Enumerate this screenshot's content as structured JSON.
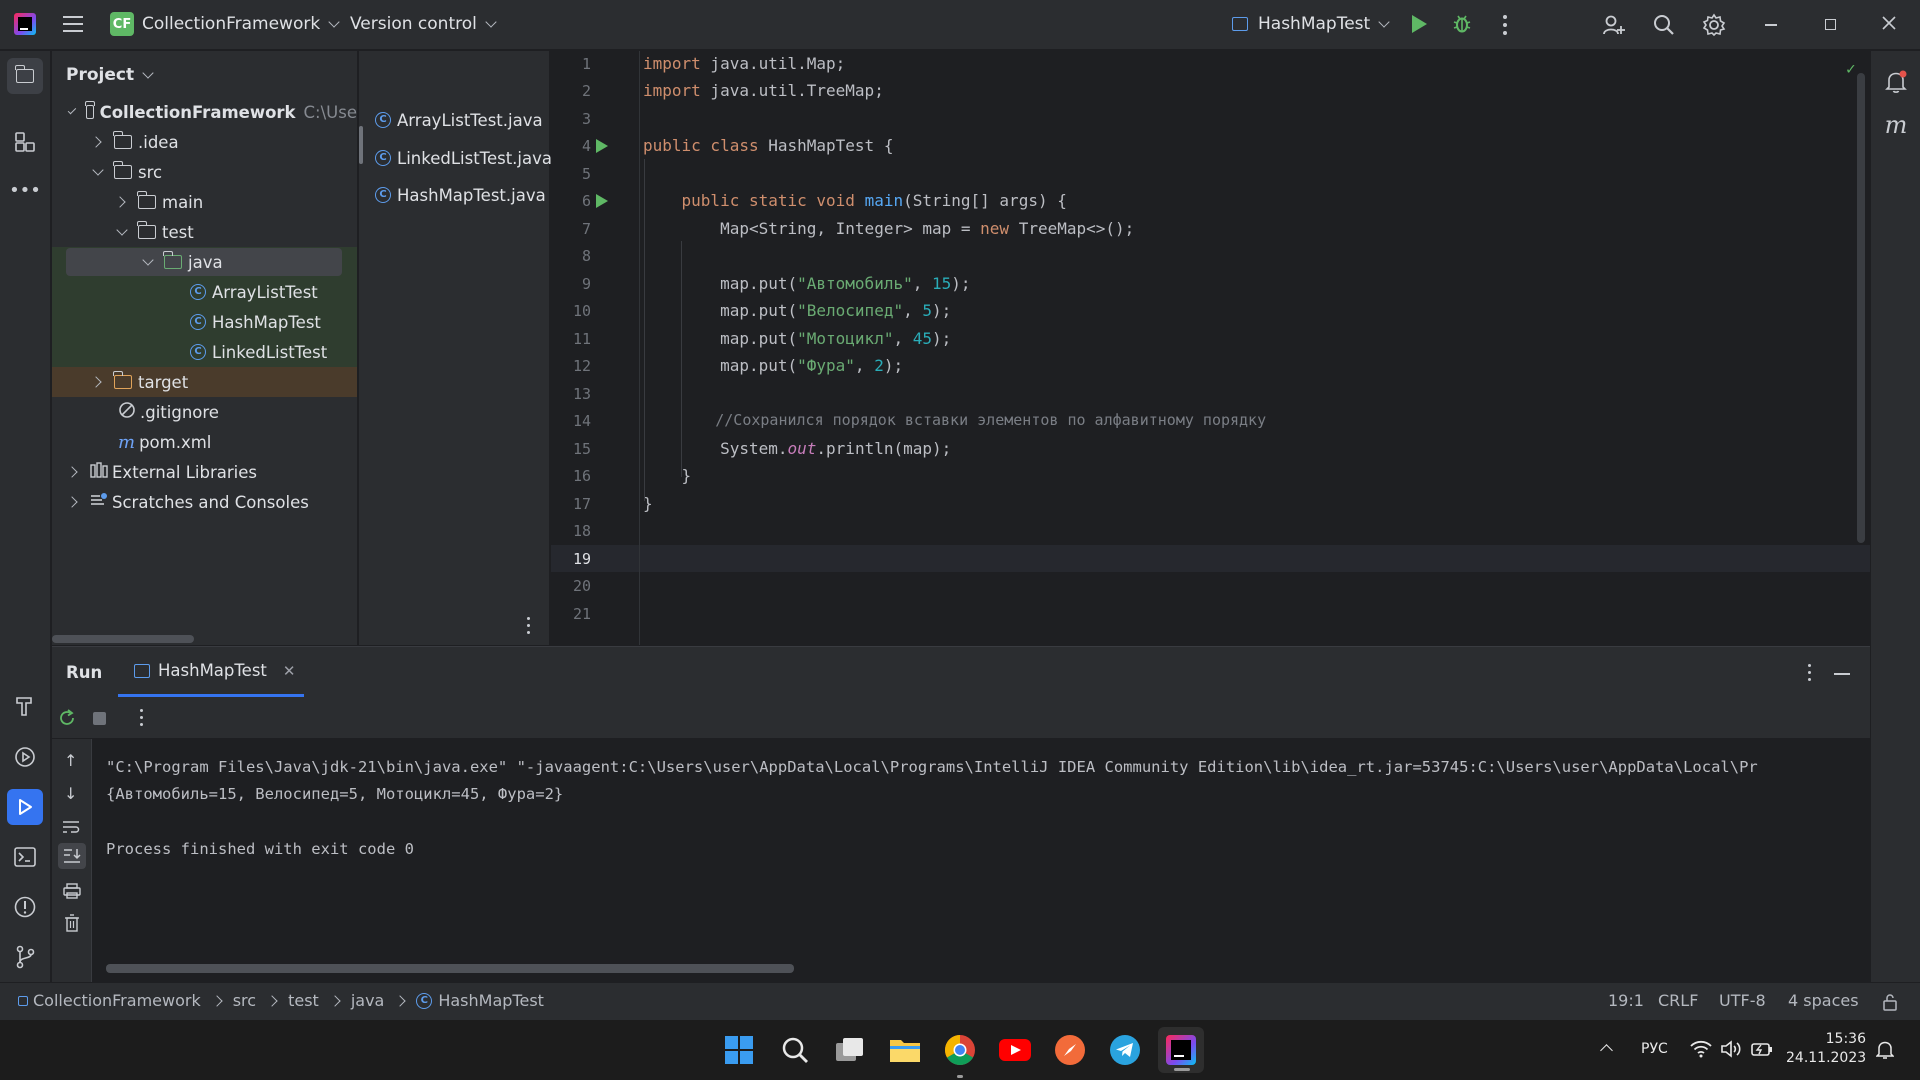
{
  "titlebar": {
    "app_logo": "intellij-logo-icon",
    "project_badge": "CF",
    "project_name": "CollectionFramework",
    "vcs": "Version control",
    "run_config": "HashMapTest"
  },
  "project_panel": {
    "title": "Project",
    "tree": [
      {
        "label": "CollectionFramework",
        "extra": "C:\\Use",
        "icon": "folder-icon"
      },
      {
        "label": ".idea",
        "icon": "folder-icon"
      },
      {
        "label": "src",
        "icon": "folder-icon"
      },
      {
        "label": "main",
        "icon": "folder-icon"
      },
      {
        "label": "test",
        "icon": "folder-icon"
      },
      {
        "label": "java",
        "icon": "folder-icon"
      },
      {
        "label": "ArrayListTest",
        "icon": "class-icon"
      },
      {
        "label": "HashMapTest",
        "icon": "class-icon"
      },
      {
        "label": "LinkedListTest",
        "icon": "class-icon"
      },
      {
        "label": "target",
        "icon": "folder-icon"
      },
      {
        "label": ".gitignore",
        "icon": "ignore-icon"
      },
      {
        "label": "pom.xml",
        "icon": "maven-icon"
      },
      {
        "label": "External Libraries",
        "icon": "library-icon"
      },
      {
        "label": "Scratches and Consoles",
        "icon": "scratches-icon"
      }
    ]
  },
  "open_files": [
    "ArrayListTest.java",
    "LinkedListTest.java",
    "HashMapTest.java"
  ],
  "editor": {
    "line_numbers": [
      "1",
      "2",
      "3",
      "4",
      "5",
      "6",
      "7",
      "8",
      "9",
      "10",
      "11",
      "12",
      "13",
      "14",
      "15",
      "16",
      "17",
      "18",
      "19",
      "20",
      "21"
    ],
    "current_line": "19",
    "code": {
      "l1_a": "import",
      "l1_b": " java.util.Map;",
      "l2_a": "import",
      "l2_b": " java.util.TreeMap;",
      "l4_a": "public class",
      "l4_b": " HashMapTest {",
      "l6_a": "    public static void",
      "l6_b": "main",
      "l6_c": "(String[] args) {",
      "l7_a": "        Map<String, Integer> map = ",
      "l7_b": "new",
      "l7_c": " TreeMap<>();",
      "l9_a": "        map.put(",
      "l9_b": "\"Автомобиль\"",
      "l9_c": ", ",
      "l9_d": "15",
      "l9_e": ");",
      "l10_a": "        map.put(",
      "l10_b": "\"Велосипед\"",
      "l10_c": ", ",
      "l10_d": "5",
      "l10_e": ");",
      "l11_a": "        map.put(",
      "l11_b": "\"Мотоцикл\"",
      "l11_c": ", ",
      "l11_d": "45",
      "l11_e": ");",
      "l12_a": "        map.put(",
      "l12_b": "\"Фура\"",
      "l12_c": ", ",
      "l12_d": "2",
      "l12_e": ");",
      "l14": "        //Сохранился порядок вставки элементов по алфавитному порядку",
      "l15_a": "        System.",
      "l15_b": "out",
      "l15_c": ".println(map);",
      "l16": "    }",
      "l17": "}"
    }
  },
  "run_panel": {
    "title": "Run",
    "tab": "HashMapTest",
    "console": [
      "\"C:\\Program Files\\Java\\jdk-21\\bin\\java.exe\" \"-javaagent:C:\\Users\\user\\AppData\\Local\\Programs\\IntelliJ IDEA Community Edition\\lib\\idea_rt.jar=53745:C:\\Users\\user\\AppData\\Local\\Pr",
      "{Автомобиль=15, Велосипед=5, Мотоцикл=45, Фура=2}",
      "",
      "Process finished with exit code 0"
    ]
  },
  "statusbar": {
    "breadcrumbs": [
      "CollectionFramework",
      "src",
      "test",
      "java",
      "HashMapTest"
    ],
    "position": "19:1",
    "line_sep": "CRLF",
    "encoding": "UTF-8",
    "indent": "4 spaces"
  },
  "taskbar": {
    "lang": "РУС",
    "time": "15:36",
    "date": "24.11.2023"
  },
  "colors": {
    "accent": "#3574f0",
    "badge": "#5fb865",
    "run_green": "#5fb865",
    "selection": "#43454a",
    "excluded": "#4a3b2b",
    "test_bg": "#2f3d2f"
  }
}
